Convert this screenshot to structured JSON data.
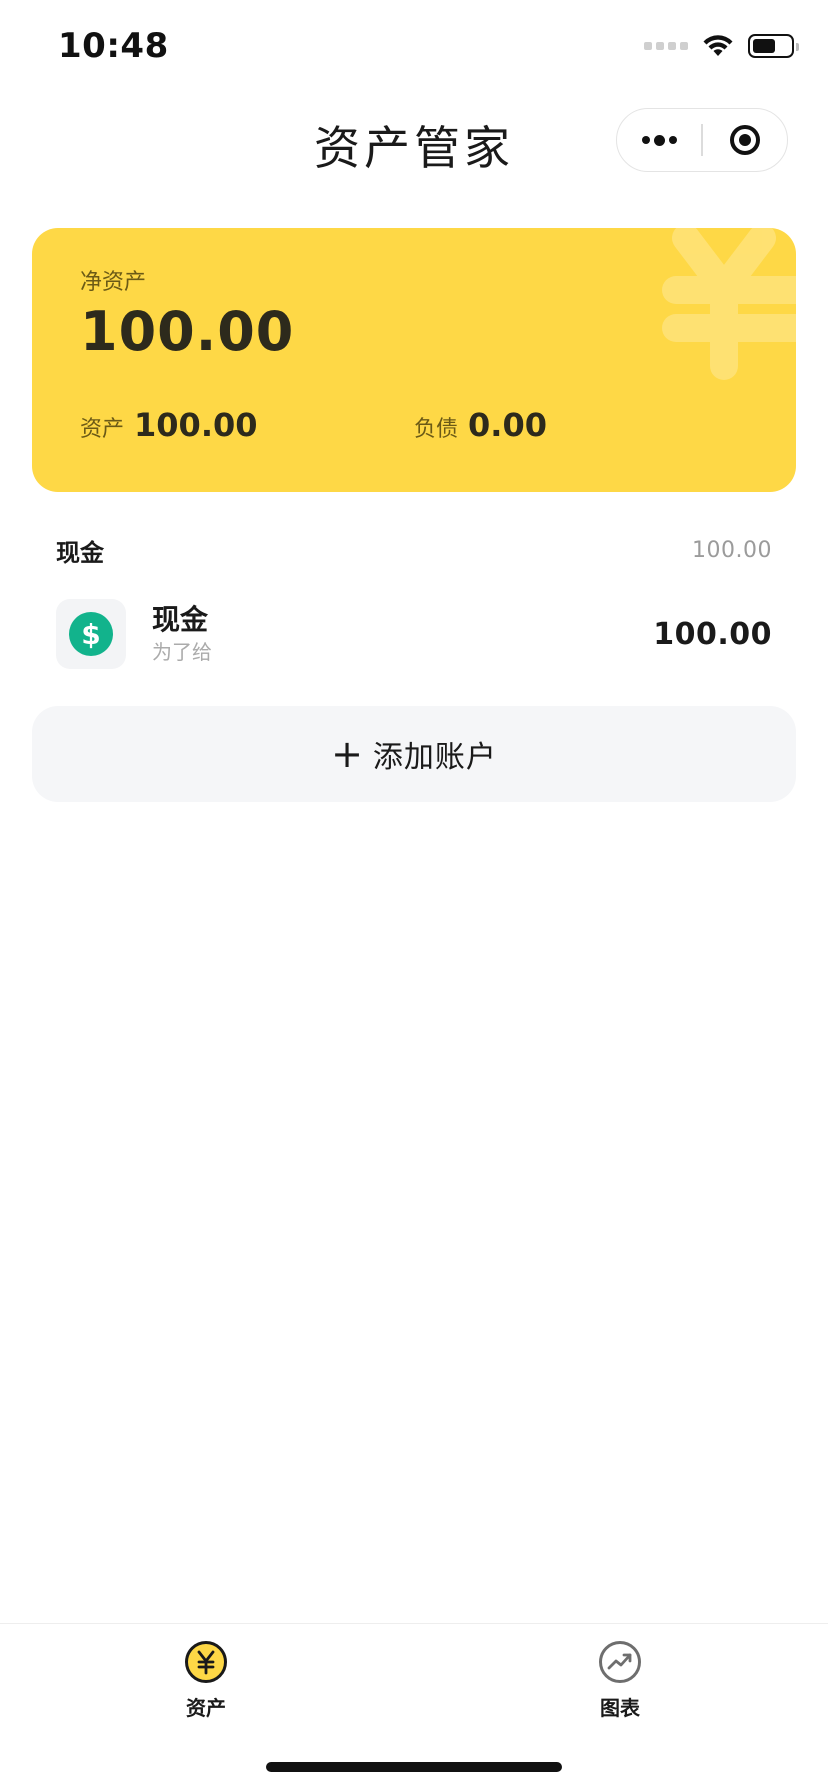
{
  "status_bar": {
    "time": "10:48"
  },
  "nav": {
    "title": "资产管家"
  },
  "summary": {
    "net_label": "净资产",
    "net_value": "100.00",
    "assets_label": "资产",
    "assets_value": "100.00",
    "debts_label": "负债",
    "debts_value": "0.00",
    "card_color": "#fed846"
  },
  "groups": [
    {
      "title": "现金",
      "total": "100.00",
      "accounts": [
        {
          "name": "现金",
          "note": "为了给",
          "amount": "100.00",
          "icon": "dollar-icon",
          "icon_color": "#12b38c"
        }
      ]
    }
  ],
  "add_account": {
    "label": "添加账户"
  },
  "tab_bar": {
    "tabs": [
      {
        "label": "资产",
        "icon": "yen-icon",
        "active": true
      },
      {
        "label": "图表",
        "icon": "trend-chart-icon",
        "active": false
      }
    ]
  }
}
